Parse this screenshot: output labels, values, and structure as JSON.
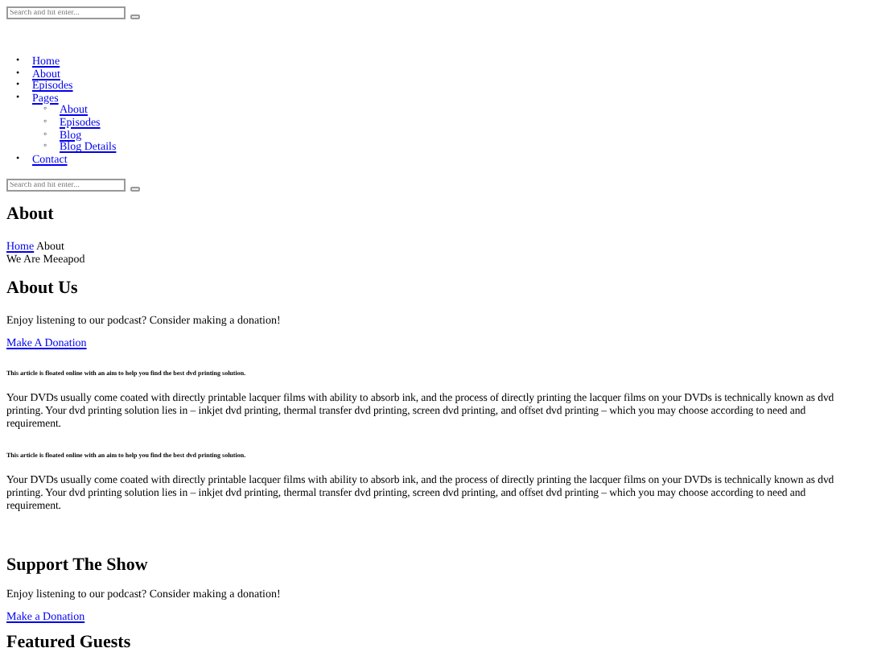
{
  "search_top": {
    "placeholder": "Search and hit enter..."
  },
  "nav": [
    {
      "marker": "•",
      "label": "Home"
    },
    {
      "marker": "•",
      "label": "About"
    },
    {
      "marker": "•",
      "label": "Episodes"
    },
    {
      "marker": "•",
      "label": "Pages",
      "children": [
        {
          "marker": "◦",
          "label": "About"
        },
        {
          "marker": "◦",
          "label": "Episodes"
        },
        {
          "marker": "◦",
          "label": "Blog"
        },
        {
          "marker": "◦",
          "label": "Blog Details"
        }
      ]
    },
    {
      "marker": "•",
      "label": "Contact"
    }
  ],
  "search_bottom": {
    "placeholder": "Search and hit enter..."
  },
  "page_title": "About",
  "breadcrumb": {
    "link": "Home",
    "current": "About"
  },
  "tagline": "We Are Meeapod",
  "about": {
    "heading": "About Us",
    "text": "Enjoy listening to our podcast? Consider making a donation!",
    "link": "Make A Donation"
  },
  "articles": [
    {
      "note": "This article is floated online with an aim to help you find the best dvd printing solution.",
      "body": "Your DVDs usually come coated with directly printable lacquer films with ability to absorb ink, and the process of directly printing the lacquer films on your DVDs is technically known as dvd printing. Your dvd printing solution lies in – inkjet dvd printing, thermal transfer dvd printing, screen dvd printing, and offset dvd printing – which you may choose according to need and requirement."
    },
    {
      "note": "This article is floated online with an aim to help you find the best dvd printing solution.",
      "body": "Your DVDs usually come coated with directly printable lacquer films with ability to absorb ink, and the process of directly printing the lacquer films on your DVDs is technically known as dvd printing. Your dvd printing solution lies in – inkjet dvd printing, thermal transfer dvd printing, screen dvd printing, and offset dvd printing – which you may choose according to need and requirement."
    }
  ],
  "support": {
    "heading": "Support The Show",
    "text": "Enjoy listening to our podcast? Consider making a donation!",
    "link": "Make a Donation"
  },
  "featured_heading": "Featured Guests"
}
